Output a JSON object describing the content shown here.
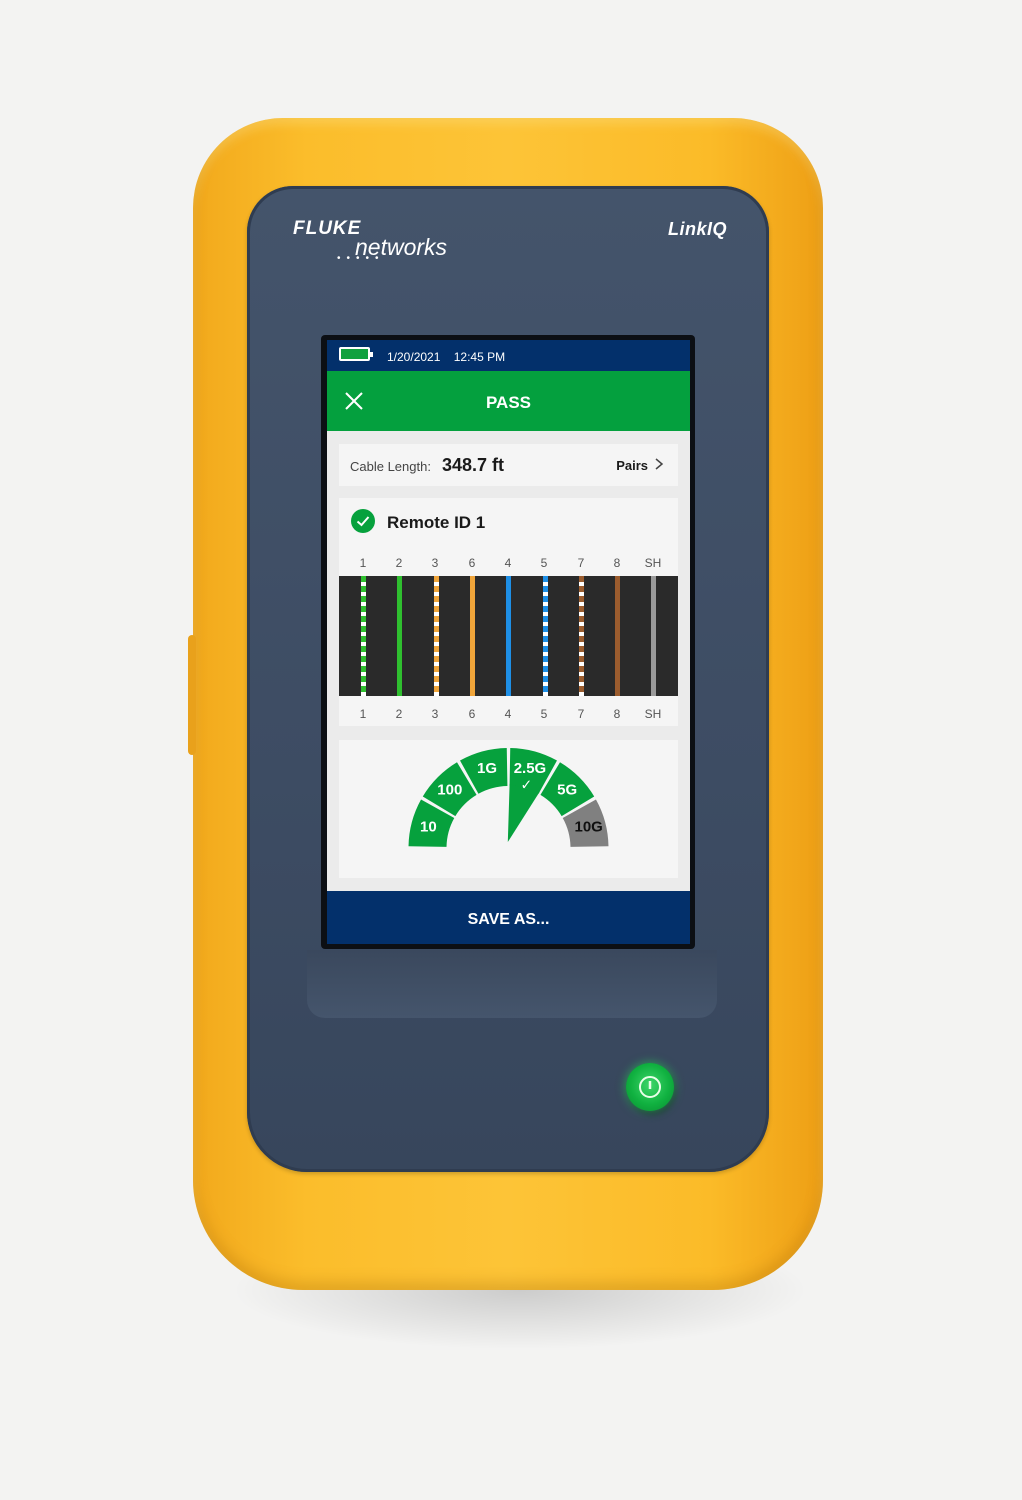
{
  "device": {
    "brand_line1": "FLUKE",
    "brand_line2": "networks",
    "brand_dots": "•••••",
    "model": "LinkIQ"
  },
  "status": {
    "date": "1/20/2021",
    "time": "12:45 PM",
    "battery_icon": "battery-full-icon"
  },
  "result": {
    "title": "PASS",
    "close_icon": "close-icon",
    "color": "#04a03e"
  },
  "cable": {
    "length_label": "Cable Length:",
    "length_value": "348.7 ft",
    "pairs_label": "Pairs",
    "pairs_icon": "chevron-right-icon"
  },
  "wiremap": {
    "remote_label": "Remote ID 1",
    "status_icon": "check-circle-icon",
    "pins_top": [
      "1",
      "2",
      "3",
      "6",
      "4",
      "5",
      "7",
      "8",
      "SH"
    ],
    "pins_bottom": [
      "1",
      "2",
      "3",
      "6",
      "4",
      "5",
      "7",
      "8",
      "SH"
    ],
    "wires": [
      {
        "pin": "1",
        "color": "#2fbf2f",
        "striped": true
      },
      {
        "pin": "2",
        "color": "#2fbf2f",
        "striped": false
      },
      {
        "pin": "3",
        "color": "#f0a53a",
        "striped": true
      },
      {
        "pin": "6",
        "color": "#f0a53a",
        "striped": false
      },
      {
        "pin": "4",
        "color": "#1e8fe6",
        "striped": false
      },
      {
        "pin": "5",
        "color": "#1e8fe6",
        "striped": true
      },
      {
        "pin": "7",
        "color": "#9b5c2e",
        "striped": true
      },
      {
        "pin": "8",
        "color": "#9b5c2e",
        "striped": false
      },
      {
        "pin": "SH",
        "color": "#9a9a9a",
        "striped": false
      }
    ]
  },
  "speed_gauge": {
    "segments": [
      {
        "label": "10",
        "supported": true
      },
      {
        "label": "100",
        "supported": true
      },
      {
        "label": "1G",
        "supported": true
      },
      {
        "label": "2.5G",
        "supported": true
      },
      {
        "label": "5G",
        "supported": true
      },
      {
        "label": "10G",
        "supported": false
      }
    ],
    "measured": "2.5G",
    "check_mark": "✓",
    "supported_color": "#06a13d",
    "unsupported_color": "#808080"
  },
  "actions": {
    "save_label": "SAVE AS..."
  },
  "power_icon": "power-icon"
}
